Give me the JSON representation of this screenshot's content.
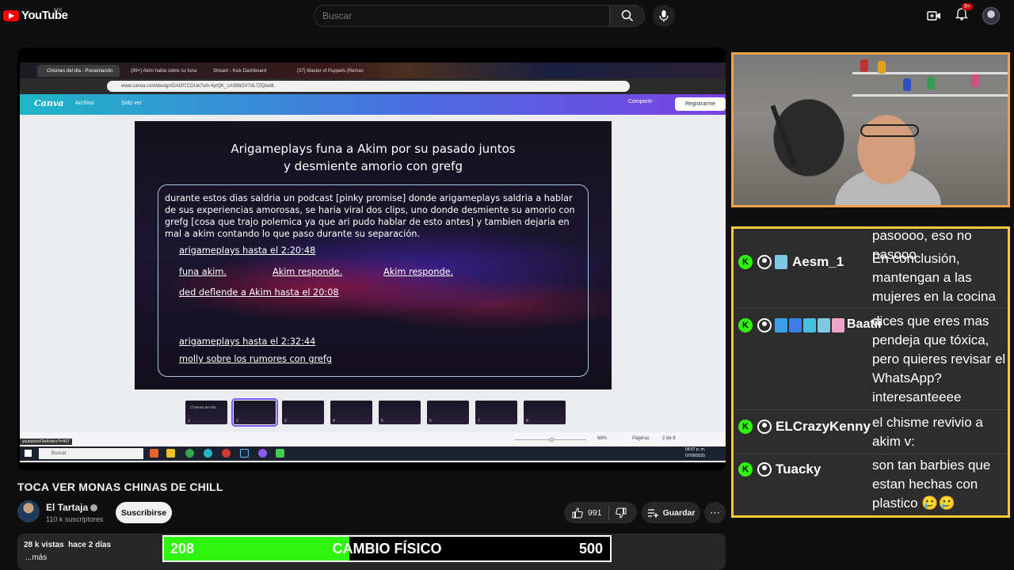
{
  "youtube": {
    "logo_text": "YouTube",
    "region": "MX",
    "search_placeholder": "Buscar",
    "notification_count": "9+"
  },
  "browser": {
    "tabs": [
      "Chismes del día - Presentación",
      "(99+) Akim habla sobre su funa",
      "Stream - Kick Dashboard",
      "(37) Master of Puppets (Remast"
    ],
    "url": "www.canva.com/design/DAGfTCOUe7o/n-4yrQK_cAS6bOV7dL7ZQ/edit",
    "status_url": "youtube/sF9sA/obrs?t=907"
  },
  "canva": {
    "logo": "Canva",
    "menu_archivo": "Archivo",
    "menu_view": "Solo ver",
    "share": "Compartir",
    "register": "Registrarme",
    "zoom": "68%",
    "pages_label": "Páginas",
    "page_indicator": "2 de 8",
    "thumb_first_title": "Chismes del día",
    "thumbnails": [
      "1",
      "2",
      "3",
      "4",
      "5",
      "6",
      "7",
      "8"
    ]
  },
  "slide": {
    "title_line1": "Arigameplays funa a Akim por su pasado juntos",
    "title_line2": "y desmiente amorio con grefg",
    "body": "durante estos dias saldria un podcast [pinky promise] donde arigameplays saldria a hablar de sus experiencias amorosas, se haria viral dos clips, uno donde desmiente su amorio con grefg [cosa que trajo polemica ya que ari pudo hablar de esto antes] y tambien dejaria en mal a akim contando lo que paso durante su separación.",
    "links": [
      "arigameplays hasta el 2:20:48",
      "funa akim.",
      "Akim responde.",
      "Akim responde.",
      "ded deflende a Akim hasta el 20:08",
      "arigameplays hasta el 2:32:44",
      "molly sobre los rumores con grefg"
    ]
  },
  "taskbar": {
    "search": "Buscar",
    "time": "04:57 p. m.",
    "date": "07/09/2025"
  },
  "video": {
    "title": "TOCA VER MONAS CHINAS DE CHILL",
    "channel": "El Tartaja",
    "subscribers": "110 k suscriptores",
    "subscribe_label": "Suscribirse",
    "likes": "991",
    "save_label": "Guardar",
    "views": "28 k vistas",
    "age": "hace 2 días",
    "more": "...más"
  },
  "goal_bar": {
    "current": "208",
    "label": "CAMBIO FÍSICO",
    "target": "500",
    "progress_fraction": 0.416,
    "fill_color": "#2ef50b"
  },
  "chat": {
    "top_partial": "pasoooo, eso no pasooo",
    "messages": [
      {
        "user": "Aesm_1",
        "text": "En conclusión, mantengan a las mujeres en la cocina"
      },
      {
        "user": "Baatii",
        "text": "dices que eres mas pendeja que tóxica, pero quieres revisar el WhatsApp? interesanteeee"
      },
      {
        "user": "ELCrazyKenny",
        "text": "el chisme revivio a akim v:"
      },
      {
        "user": "Tuacky",
        "text": "son tan barbies que estan hechas con plastico 🥲🥲"
      }
    ],
    "k_icon": "K",
    "border_color": "#f8c935"
  },
  "cam": {
    "border_color": "#f6a14a"
  }
}
